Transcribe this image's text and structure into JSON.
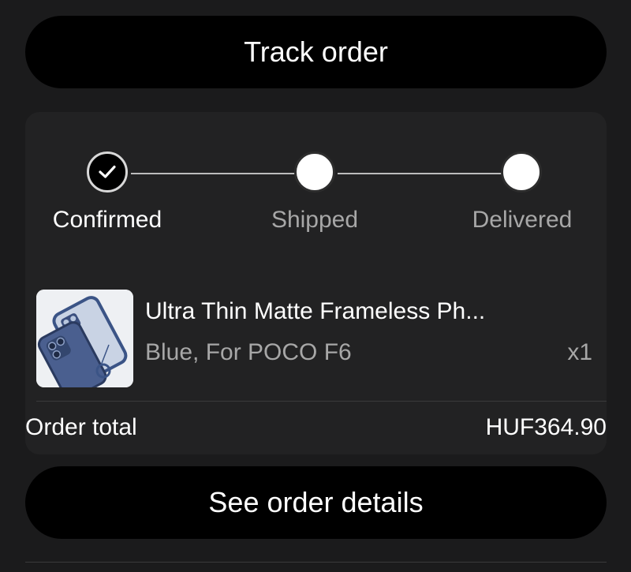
{
  "buttons": {
    "track_order": "Track order",
    "see_order_details": "See order details"
  },
  "progress": {
    "steps": [
      {
        "label": "Confirmed",
        "state": "done"
      },
      {
        "label": "Shipped",
        "state": "pending"
      },
      {
        "label": "Delivered",
        "state": "pending"
      }
    ]
  },
  "product": {
    "title": "Ultra Thin Matte Frameless Ph...",
    "variant": "Blue, For POCO F6",
    "quantity": "x1",
    "image_icon": "phone-case-image"
  },
  "order": {
    "total_label": "Order total",
    "total_value": "HUF364.90"
  },
  "colors": {
    "background": "#1b1b1c",
    "card": "#222223",
    "button": "#000000",
    "muted_text": "#a7a7a7"
  }
}
